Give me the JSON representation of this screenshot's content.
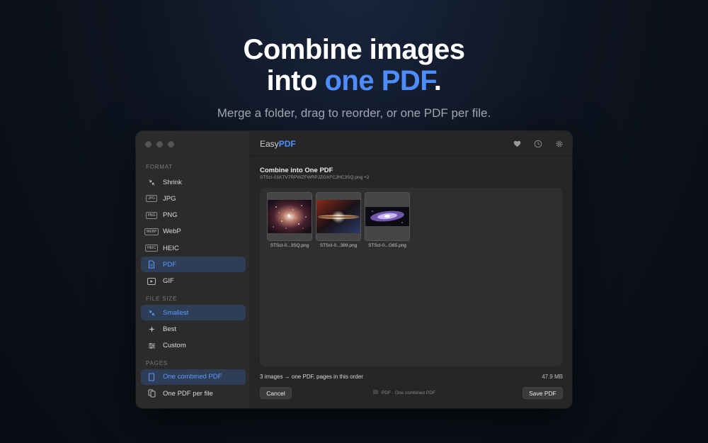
{
  "hero": {
    "title_line1": "Combine images",
    "title_line2_pre": "into ",
    "title_line2_accent": "one PDF",
    "title_line2_post": ".",
    "subtitle": "Merge a folder, drag to reorder, or one PDF per file."
  },
  "colors": {
    "accent": "#4d8dff",
    "active_bg": "#2f3e57"
  },
  "sidebar": {
    "format_heading": "FORMAT",
    "format_items": [
      {
        "label": "Shrink",
        "icon": "shrink-icon"
      },
      {
        "label": "JPG",
        "icon": "jpg-badge-icon",
        "badge": "JPG"
      },
      {
        "label": "PNG",
        "icon": "png-badge-icon",
        "badge": "PNG"
      },
      {
        "label": "WebP",
        "icon": "webp-badge-icon",
        "badge": "WEBP"
      },
      {
        "label": "HEIC",
        "icon": "heic-badge-icon",
        "badge": "HEIC"
      },
      {
        "label": "PDF",
        "icon": "document-icon",
        "active": true
      },
      {
        "label": "GIF",
        "icon": "play-icon"
      }
    ],
    "filesize_heading": "FILE SIZE",
    "filesize_items": [
      {
        "label": "Smallest",
        "icon": "compress-icon",
        "active": true
      },
      {
        "label": "Best",
        "icon": "sparkle-icon"
      },
      {
        "label": "Custom",
        "icon": "sliders-icon"
      }
    ],
    "pages_heading": "PAGES",
    "pages_items": [
      {
        "label": "One combined PDF",
        "icon": "single-file-icon",
        "active": true
      },
      {
        "label": "One PDF per file",
        "icon": "multi-file-icon"
      }
    ]
  },
  "app": {
    "brand_part1": "Easy",
    "brand_part2": "PDF",
    "toolbar_icons": [
      "heart-icon",
      "history-icon",
      "gear-icon"
    ],
    "job_title": "Combine into One PDF",
    "job_subtitle": "STScI-01KTV7RPWZFWRPJZGXFCJHC3SQ.png +2",
    "thumbnails": [
      {
        "caption": "STScI-0...3SQ.png"
      },
      {
        "caption": "STScI-0...389.png"
      },
      {
        "caption": "STScI-0...G65.png"
      }
    ],
    "summary": "3 images → one PDF, pages in this order",
    "total_size": "47.9 MB",
    "cancel_label": "Cancel",
    "status_text": "PDF · One combined PDF",
    "save_label": "Save PDF"
  }
}
